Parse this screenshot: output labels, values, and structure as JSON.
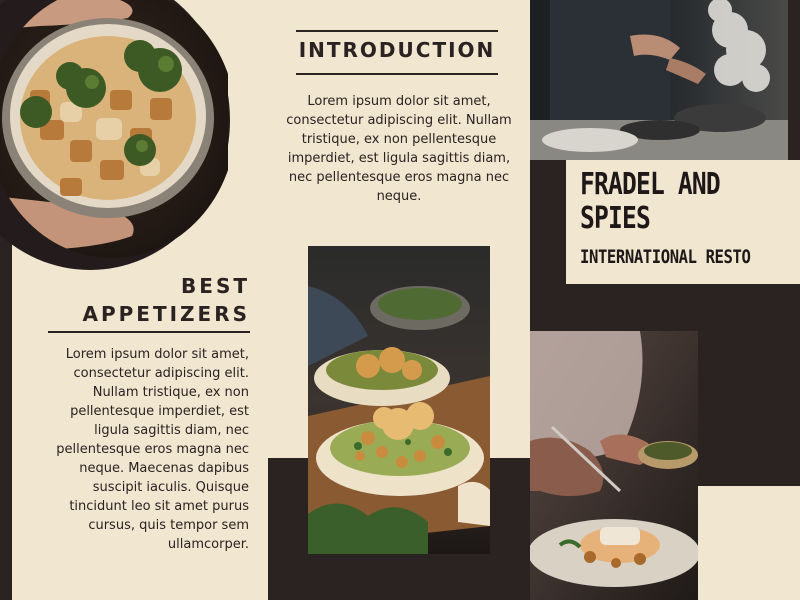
{
  "panel_left": {
    "heading": "BEST\nAPPETIZERS",
    "body": "Lorem ipsum dolor sit amet, consectetur adipiscing elit. Nullam tristique, ex non pellentesque imperdiet, est ligula sagittis diam, nec pellentesque eros magna nec neque. Maecenas dapibus suscipit iaculis. Quisque tincidunt leo sit amet purus cursus, quis tempor sem ullamcorper."
  },
  "panel_center": {
    "heading": "INTRODUCTION",
    "body": "Lorem ipsum dolor sit amet, consectetur adipiscing elit. Nullam tristique, ex non pellentesque imperdiet, est ligula sagittis diam, nec pellentesque eros magna nec neque."
  },
  "panel_right": {
    "brand_name": "FRADEL AND\nSPIES",
    "brand_subtitle": "INTERNATIONAL RESTO"
  },
  "colors": {
    "cream": "#f1e6cf",
    "dark": "#2b2222"
  }
}
